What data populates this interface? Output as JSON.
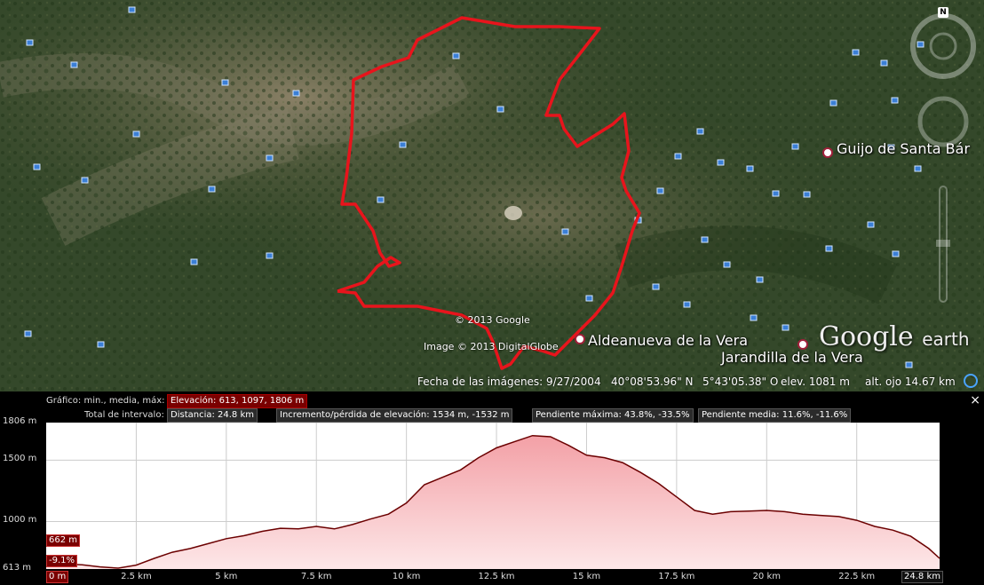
{
  "map": {
    "places": [
      {
        "name": "Guijo de Santa Bár"
      },
      {
        "name": "Aldeanueva de la Vera"
      },
      {
        "name": "Jarandilla de la Vera"
      }
    ],
    "credits": {
      "copyright": "© 2013 Google",
      "imagery": "Image © 2013 DigitalGlobe"
    },
    "status": {
      "image_date": "Fecha de las imágenes: 9/27/2004",
      "lat": "40°08'53.96\" N",
      "lon": "5°43'05.38\" O",
      "elev": "elev.  1081 m",
      "eye_alt": "alt. ojo  14.67 km"
    },
    "logo": {
      "brand": "Google",
      "product": "earth"
    },
    "compass_letter": "N",
    "route_color": "#e8141c"
  },
  "profile": {
    "graph_label": "Gráfico:",
    "graph_stats": "min., media, máx:",
    "elevation_box": "Elevación: 613, 1097, 1806 m",
    "range_label": "Total de intervalo:",
    "distance_box": "Distancia: 24.8 km",
    "gain_box": "Incremento/pérdida de elevación: 1534 m, -1532 m",
    "max_slope_box": "Pendiente máxima: 43.8%, -33.5%",
    "avg_slope_box": "Pendiente media: 11.6%, -11.6%",
    "close": "×",
    "cursor_elev": "662 m",
    "cursor_slope": "-9.1%",
    "cursor_dist": "0 m",
    "end_dist": "24.8 km"
  },
  "chart_data": {
    "type": "area",
    "xlabel": "",
    "ylabel": "",
    "x_unit": "km",
    "xlim": [
      0,
      24.8
    ],
    "ylim": [
      613,
      1806
    ],
    "yticks": [
      {
        "v": 1806,
        "label": "1806 m"
      },
      {
        "v": 1500,
        "label": "1500 m"
      },
      {
        "v": 1000,
        "label": "1000 m"
      },
      {
        "v": 613,
        "label": "613 m"
      }
    ],
    "xticks": [
      {
        "v": 2.5,
        "label": "2.5 km"
      },
      {
        "v": 5,
        "label": "5 km"
      },
      {
        "v": 7.5,
        "label": "7.5 km"
      },
      {
        "v": 10,
        "label": "10 km"
      },
      {
        "v": 12.5,
        "label": "12.5 km"
      },
      {
        "v": 15,
        "label": "15 km"
      },
      {
        "v": 17.5,
        "label": "17.5 km"
      },
      {
        "v": 20,
        "label": "20 km"
      },
      {
        "v": 22.5,
        "label": "22.5 km"
      }
    ],
    "series": [
      {
        "fill": "#f3a0a6",
        "line": "#6b0000",
        "x": [
          0,
          0.5,
          1,
          1.5,
          2,
          2.5,
          3,
          3.5,
          4,
          4.5,
          5,
          5.5,
          6,
          6.5,
          7,
          7.5,
          8,
          8.5,
          9,
          9.5,
          10,
          10.5,
          11,
          11.5,
          12,
          12.5,
          13,
          13.5,
          14,
          14.5,
          15,
          15.5,
          16,
          16.5,
          17,
          17.5,
          18,
          18.5,
          19,
          19.5,
          20,
          20.5,
          21,
          21.5,
          22,
          22.5,
          23,
          23.5,
          24,
          24.5,
          24.8
        ],
        "y": [
          640,
          655,
          648,
          630,
          620,
          645,
          700,
          750,
          780,
          820,
          860,
          885,
          920,
          945,
          940,
          960,
          940,
          975,
          1020,
          1060,
          1150,
          1300,
          1360,
          1420,
          1520,
          1600,
          1650,
          1700,
          1690,
          1620,
          1540,
          1520,
          1480,
          1400,
          1310,
          1200,
          1090,
          1060,
          1080,
          1085,
          1090,
          1080,
          1060,
          1050,
          1040,
          1010,
          960,
          930,
          880,
          780,
          700
        ]
      }
    ]
  }
}
